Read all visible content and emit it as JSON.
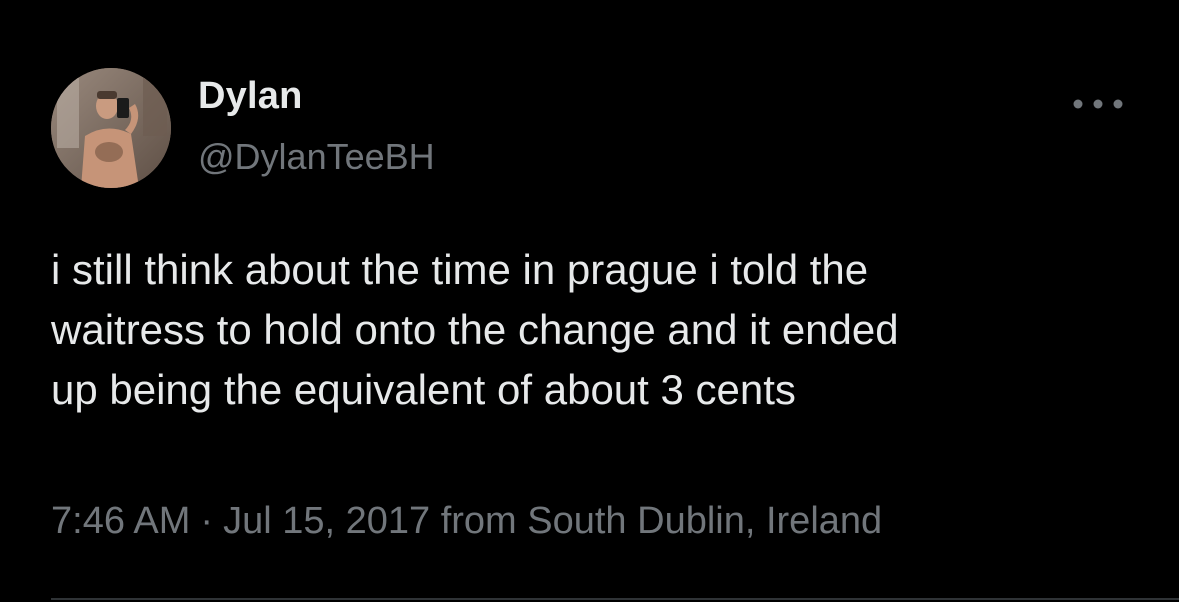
{
  "author": {
    "display_name": "Dylan",
    "handle": "@DylanTeeBH"
  },
  "tweet": {
    "lines": [
      "i still think about the time in prague i told the",
      "waitress to hold onto the change and it ended",
      "up being the equivalent of about 3 cents"
    ]
  },
  "meta": {
    "time": "7:46 AM",
    "separator": "·",
    "date": "Jul 15, 2017",
    "location": "from South Dublin, Ireland"
  },
  "icons": {
    "more": "more-options-icon"
  },
  "colors": {
    "background": "#000000",
    "primary_text": "#e7e9ea",
    "secondary_text": "#71767b",
    "divider": "#2f3336"
  }
}
